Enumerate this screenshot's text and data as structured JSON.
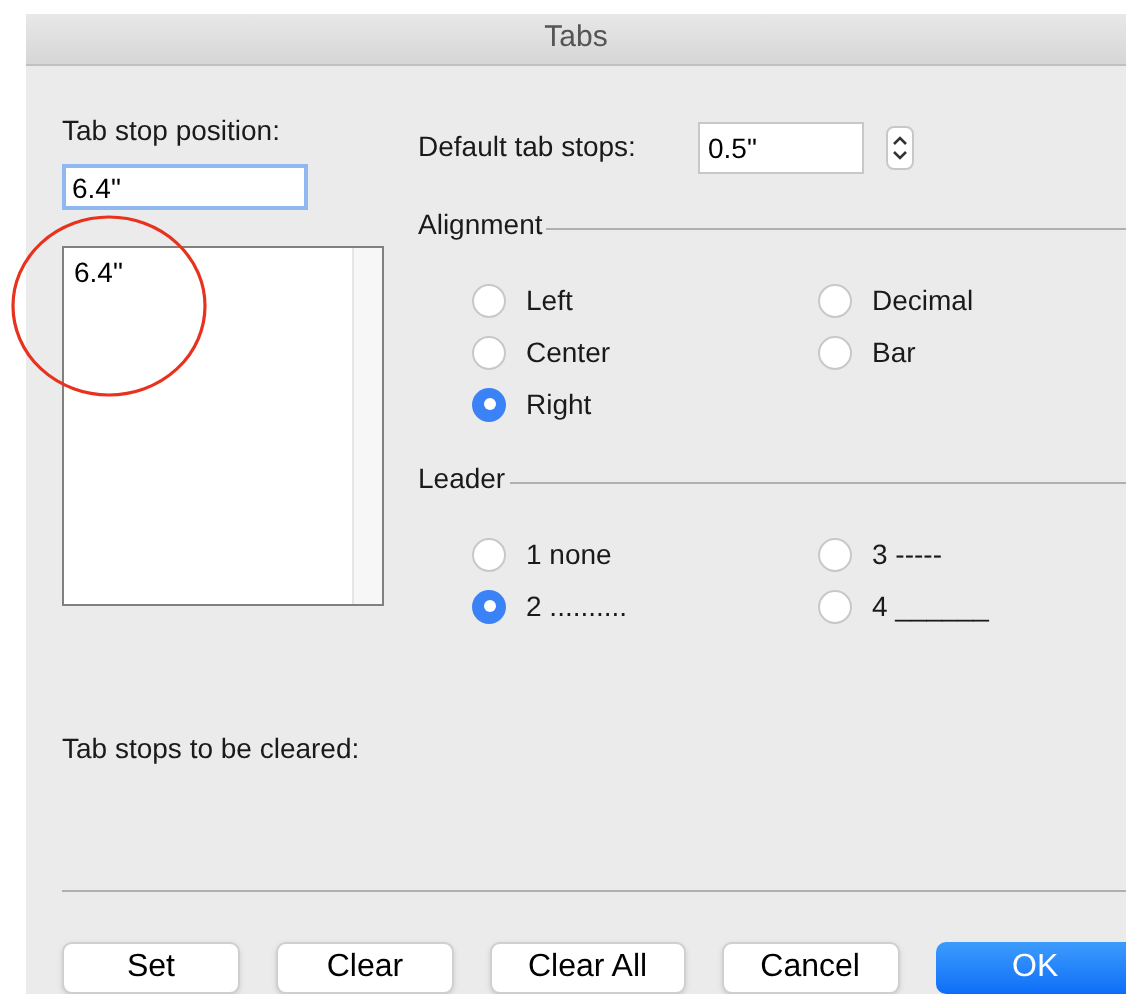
{
  "window": {
    "title": "Tabs"
  },
  "tab_stop_position": {
    "label": "Tab stop position:",
    "value": "6.4\""
  },
  "tab_stop_list": [
    "6.4\""
  ],
  "default_tab_stops": {
    "label": "Default tab stops:",
    "value": "0.5\""
  },
  "alignment": {
    "label": "Alignment",
    "options": [
      {
        "label": "Left",
        "selected": false
      },
      {
        "label": "Decimal",
        "selected": false
      },
      {
        "label": "Center",
        "selected": false
      },
      {
        "label": "Bar",
        "selected": false
      },
      {
        "label": "Right",
        "selected": true
      }
    ]
  },
  "leader": {
    "label": "Leader",
    "options": [
      {
        "label": "1 none",
        "selected": false
      },
      {
        "label": "3 -----",
        "selected": false
      },
      {
        "label": "2 ..........",
        "selected": true
      },
      {
        "label": "4 ______",
        "selected": false
      }
    ]
  },
  "clear_label": "Tab stops to be cleared:",
  "buttons": [
    {
      "label": "Set",
      "kind": "default"
    },
    {
      "label": "Clear",
      "kind": "default"
    },
    {
      "label": "Clear All",
      "kind": "default"
    },
    {
      "label": "Cancel",
      "kind": "default"
    },
    {
      "label": "OK",
      "kind": "primary"
    }
  ]
}
